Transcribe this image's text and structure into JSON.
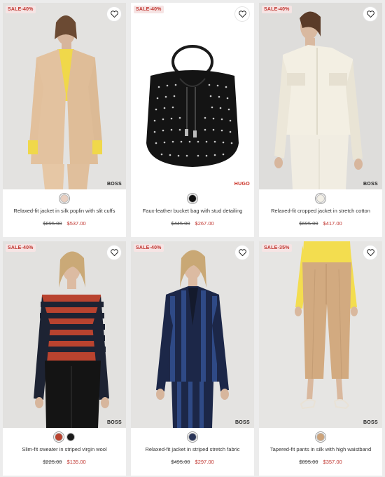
{
  "products": [
    {
      "badge": "SALE-40%",
      "brand": "BOSS",
      "name": "Relaxed-fit jacket in silk poplin with slit cuffs",
      "old_price": "$895.00",
      "new_price": "$537.00",
      "swatches": [
        "#e9cfc0"
      ]
    },
    {
      "badge": "SALE-40%",
      "brand": "HUGO",
      "name": "Faux-leather bucket bag with stud detailing",
      "old_price": "$445.00",
      "new_price": "$267.00",
      "swatches": [
        "#111111"
      ]
    },
    {
      "badge": "SALE-40%",
      "brand": "BOSS",
      "name": "Relaxed-fit cropped jacket in stretch cotton",
      "old_price": "$695.00",
      "new_price": "$417.00",
      "swatches": [
        "#f2efe6"
      ]
    },
    {
      "badge": "SALE-40%",
      "brand": "BOSS",
      "name": "Slim-fit sweater in striped virgin wool",
      "old_price": "$225.00",
      "new_price": "$135.00",
      "swatches": [
        "#b9432f",
        "#1a1a1a"
      ]
    },
    {
      "badge": "SALE-40%",
      "brand": "BOSS",
      "name": "Relaxed-fit jacket in striped stretch fabric",
      "old_price": "$495.00",
      "new_price": "$297.00",
      "swatches": [
        "#2a3558"
      ]
    },
    {
      "badge": "SALE-35%",
      "brand": "BOSS",
      "name": "Tapered-fit pants in silk with high waistband",
      "old_price": "$895.00",
      "new_price": "$357.00",
      "swatches": [
        "#cda37a"
      ]
    }
  ],
  "colors": {
    "sale": "#c0352f",
    "hugo": "#c8281c"
  }
}
